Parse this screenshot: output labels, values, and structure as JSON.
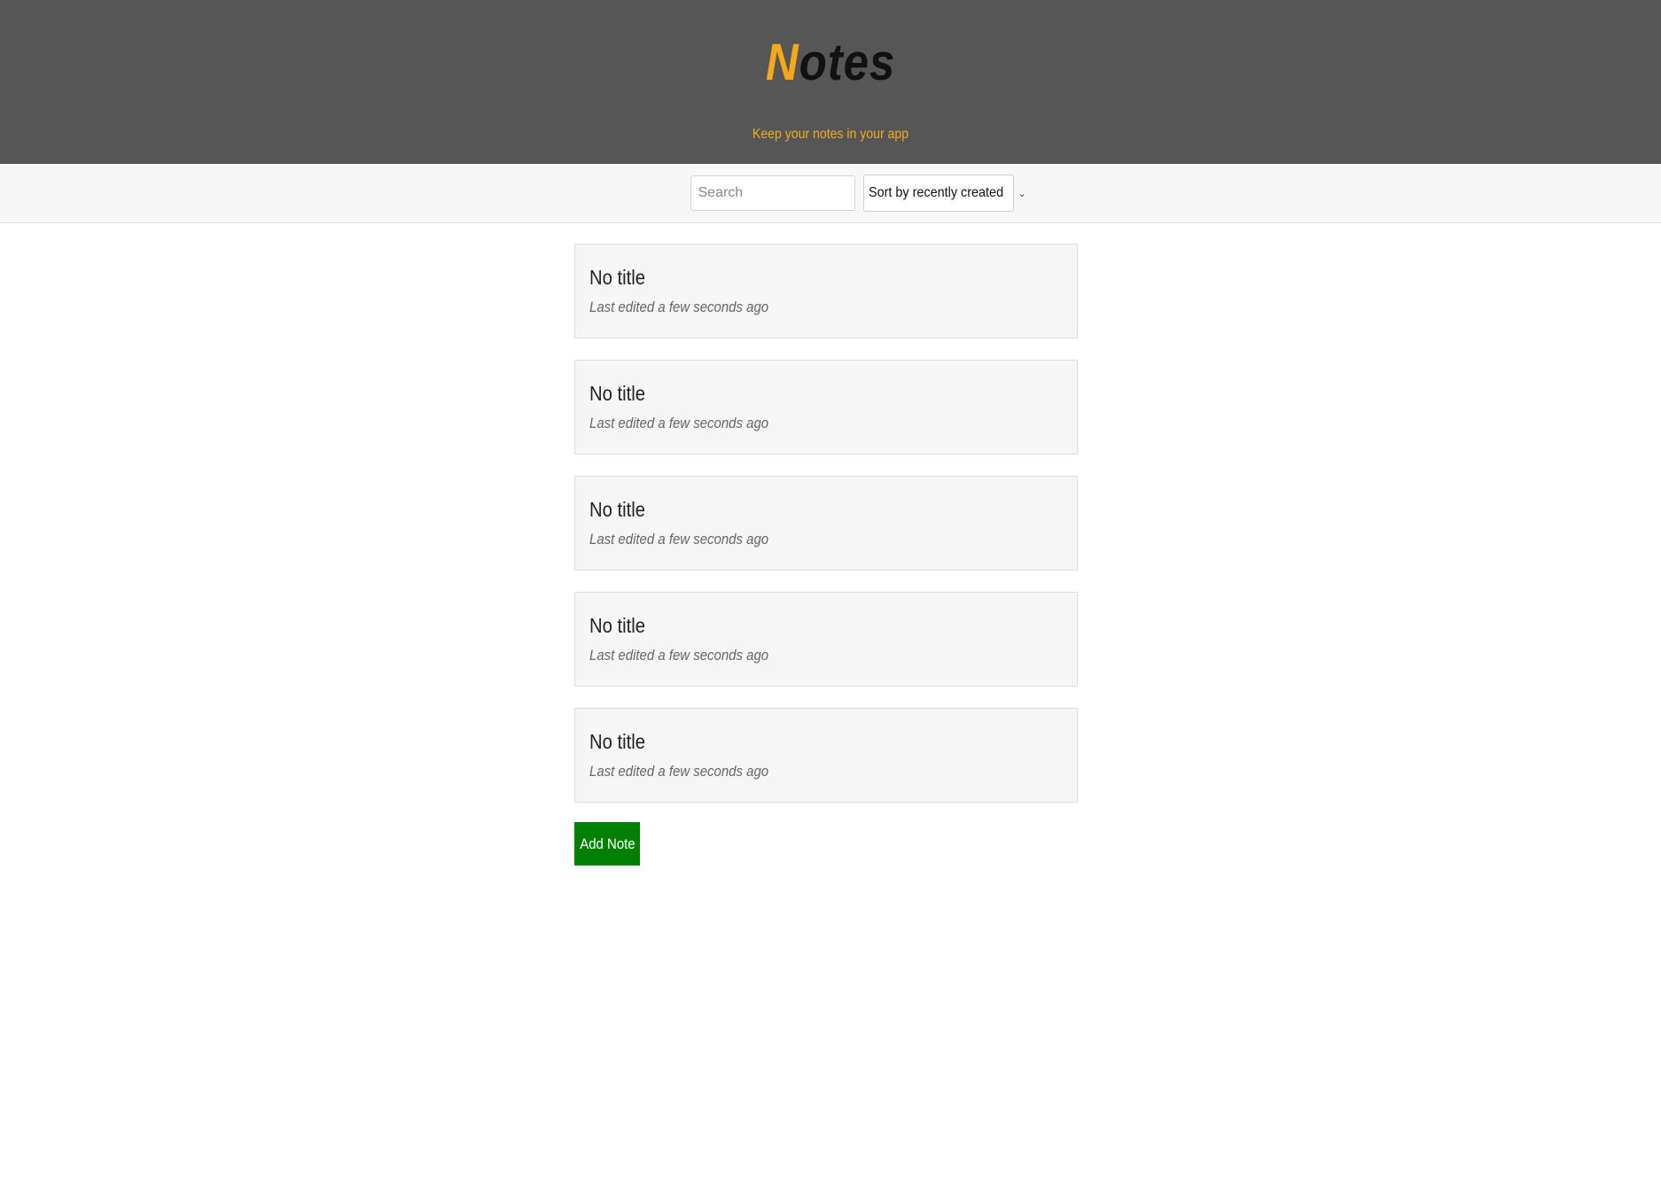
{
  "header": {
    "logo_first": "N",
    "logo_rest": "otes",
    "tagline": "Keep your notes in your app"
  },
  "toolbar": {
    "search_placeholder": "Search",
    "sort_selected": "Sort by recently created"
  },
  "notes": [
    {
      "title": "No title",
      "meta": "Last edited a few seconds ago"
    },
    {
      "title": "No title",
      "meta": "Last edited a few seconds ago"
    },
    {
      "title": "No title",
      "meta": "Last edited a few seconds ago"
    },
    {
      "title": "No title",
      "meta": "Last edited a few seconds ago"
    },
    {
      "title": "No title",
      "meta": "Last edited a few seconds ago"
    }
  ],
  "add_button_label": "Add Note",
  "colors": {
    "header_bg": "#565656",
    "accent": "#f5a81c",
    "add_button": "#008000"
  }
}
